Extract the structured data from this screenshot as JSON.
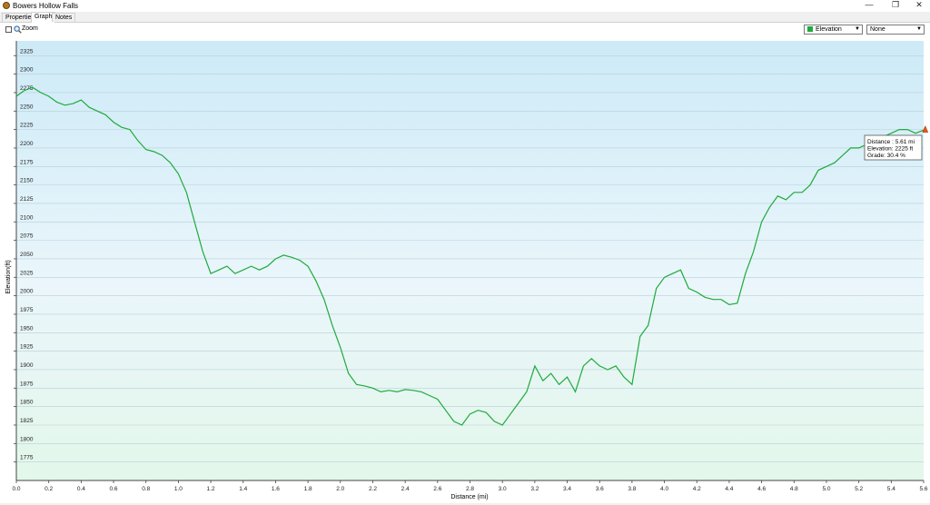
{
  "window": {
    "title": "Bowers Hollow Falls"
  },
  "tabs": [
    {
      "label": "Properties"
    },
    {
      "label": "Graph"
    },
    {
      "label": "Notes"
    }
  ],
  "toolbar": {
    "zoom_label": "Zoom",
    "zoom_checked": false,
    "series_select": "Elevation",
    "compare_select": "None"
  },
  "colors": {
    "line": "#1faa3c",
    "marker": "#e05a20",
    "plot_top": "#cdeaf7",
    "plot_bottom": "#e6f8ee"
  },
  "tooltip": {
    "line1": "Distance : 5.61 mi",
    "line2": "Elevation: 2225 ft",
    "line3": "Grade: 30.4 %"
  },
  "chart_data": {
    "type": "line",
    "xlabel": "Distance  (mi)",
    "ylabel": "Elevation(ft)",
    "xlim": [
      0,
      5.6
    ],
    "ylim": [
      1750,
      2345
    ],
    "xticks": [
      "0.0",
      "0.2",
      "0.4",
      "0.6",
      "0.8",
      "1.0",
      "1.2",
      "1.4",
      "1.6",
      "1.8",
      "2.0",
      "2.2",
      "2.4",
      "2.6",
      "2.8",
      "3.0",
      "3.2",
      "3.4",
      "3.6",
      "3.8",
      "4.0",
      "4.2",
      "4.4",
      "4.6",
      "4.8",
      "5.0",
      "5.2",
      "5.4",
      "5.6"
    ],
    "yticks": [
      "1775",
      "1800",
      "1825",
      "1850",
      "1875",
      "1900",
      "1925",
      "1950",
      "1975",
      "2000",
      "2025",
      "2050",
      "2075",
      "2100",
      "2125",
      "2150",
      "2175",
      "2200",
      "2225",
      "2250",
      "2275",
      "2300",
      "2325"
    ],
    "grid": true,
    "series": [
      {
        "x": [
          0.0,
          0.05,
          0.1,
          0.15,
          0.2,
          0.25,
          0.3,
          0.35,
          0.4,
          0.45,
          0.5,
          0.55,
          0.6,
          0.65,
          0.7,
          0.75,
          0.8,
          0.85,
          0.9,
          0.95,
          1.0,
          1.05,
          1.1,
          1.15,
          1.2,
          1.25,
          1.3,
          1.35,
          1.4,
          1.45,
          1.5,
          1.55,
          1.6,
          1.65,
          1.7,
          1.75,
          1.8,
          1.85,
          1.9,
          1.95,
          2.0,
          2.05,
          2.1,
          2.15,
          2.2,
          2.25,
          2.3,
          2.35,
          2.4,
          2.45,
          2.5,
          2.55,
          2.6,
          2.65,
          2.7,
          2.75,
          2.8,
          2.85,
          2.9,
          2.95,
          3.0,
          3.05,
          3.1,
          3.15,
          3.2,
          3.25,
          3.3,
          3.35,
          3.4,
          3.45,
          3.5,
          3.55,
          3.6,
          3.65,
          3.7,
          3.75,
          3.8,
          3.85,
          3.9,
          3.95,
          4.0,
          4.05,
          4.1,
          4.15,
          4.2,
          4.25,
          4.3,
          4.35,
          4.4,
          4.45,
          4.5,
          4.55,
          4.6,
          4.65,
          4.7,
          4.75,
          4.8,
          4.85,
          4.9,
          4.95,
          5.0,
          5.05,
          5.1,
          5.15,
          5.2,
          5.25,
          5.3,
          5.35,
          5.4,
          5.45,
          5.5,
          5.55,
          5.61
        ],
        "y": [
          2270,
          2278,
          2282,
          2275,
          2270,
          2262,
          2258,
          2260,
          2265,
          2255,
          2250,
          2245,
          2235,
          2228,
          2225,
          2210,
          2198,
          2195,
          2190,
          2180,
          2165,
          2140,
          2100,
          2060,
          2030,
          2035,
          2040,
          2030,
          2035,
          2040,
          2035,
          2040,
          2050,
          2055,
          2052,
          2048,
          2040,
          2020,
          1995,
          1960,
          1930,
          1895,
          1880,
          1878,
          1875,
          1870,
          1872,
          1870,
          1873,
          1872,
          1870,
          1865,
          1860,
          1845,
          1830,
          1825,
          1840,
          1845,
          1842,
          1830,
          1825,
          1840,
          1855,
          1870,
          1905,
          1885,
          1895,
          1880,
          1890,
          1870,
          1905,
          1915,
          1905,
          1900,
          1905,
          1890,
          1880,
          1945,
          1960,
          2010,
          2025,
          2030,
          2035,
          2010,
          2005,
          1998,
          1995,
          1995,
          1988,
          1990,
          2030,
          2060,
          2100,
          2120,
          2135,
          2130,
          2140,
          2140,
          2150,
          2170,
          2175,
          2180,
          2190,
          2200,
          2200,
          2205,
          2210,
          2215,
          2220,
          2225,
          2225,
          2220,
          2225
        ]
      }
    ]
  }
}
